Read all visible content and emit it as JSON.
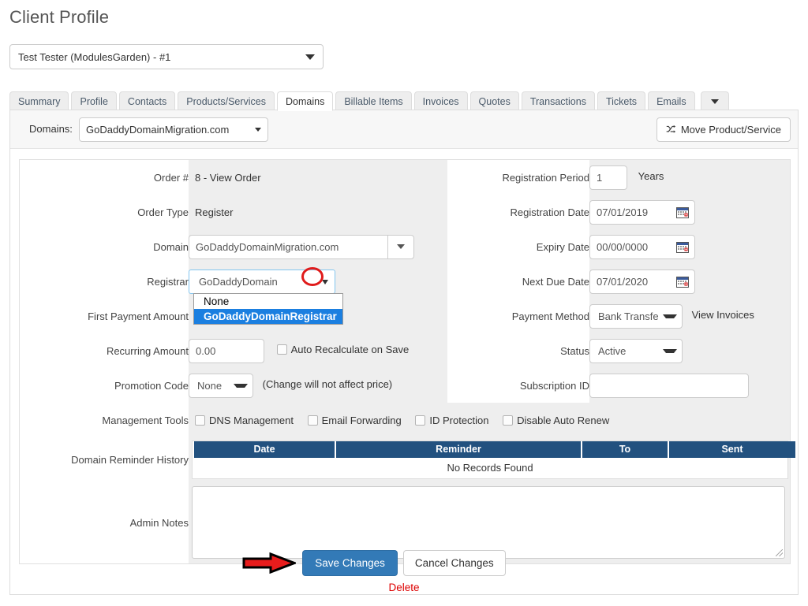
{
  "page": {
    "title": "Client Profile"
  },
  "client_select": {
    "value": "Test Tester (ModulesGarden) - #1",
    "caret": "chevron-down-icon"
  },
  "tabs": [
    {
      "label": "Summary",
      "active": false
    },
    {
      "label": "Profile",
      "active": false
    },
    {
      "label": "Contacts",
      "active": false
    },
    {
      "label": "Products/Services",
      "active": false
    },
    {
      "label": "Domains",
      "active": true
    },
    {
      "label": "Billable Items",
      "active": false
    },
    {
      "label": "Invoices",
      "active": false
    },
    {
      "label": "Quotes",
      "active": false
    },
    {
      "label": "Transactions",
      "active": false
    },
    {
      "label": "Tickets",
      "active": false
    },
    {
      "label": "Emails",
      "active": false
    }
  ],
  "panel_topbar": {
    "domains_label": "Domains:",
    "domains_value": "GoDaddyDomainMigration.com",
    "move_button": "Move Product/Service",
    "move_icon": "shuffle-icon"
  },
  "form": {
    "left": {
      "order_number_label": "Order #",
      "order_number_value": "8 - View Order",
      "order_type_label": "Order Type",
      "order_type_value": "Register",
      "domain_label": "Domain",
      "domain_value": "GoDaddyDomainMigration.com",
      "registrar_label": "Registrar",
      "registrar_value": "GoDaddyDomain",
      "registrar_options": [
        "None",
        "GoDaddyDomainRegistrar"
      ],
      "registrar_selected_option": "GoDaddyDomainRegistrar",
      "first_payment_label": "First Payment Amount",
      "first_payment_value": "",
      "recurring_amount_label": "Recurring Amount",
      "recurring_amount_value": "0.00",
      "auto_recalculate_label": "Auto Recalculate on Save",
      "promotion_code_label": "Promotion Code",
      "promotion_code_value": "None",
      "promotion_note": "(Change will not affect price)",
      "management_tools_label": "Management Tools",
      "management_tools": [
        "DNS Management",
        "Email Forwarding",
        "ID Protection",
        "Disable Auto Renew"
      ],
      "reminder_history_label": "Domain Reminder History",
      "admin_notes_label": "Admin Notes",
      "admin_notes_value": ""
    },
    "right": {
      "registration_period_label": "Registration Period",
      "registration_period_value": "1",
      "registration_period_unit": "Years",
      "registration_date_label": "Registration Date",
      "registration_date_value": "07/01/2019",
      "expiry_date_label": "Expiry Date",
      "expiry_date_value": "00/00/0000",
      "next_due_date_label": "Next Due Date",
      "next_due_date_value": "07/01/2020",
      "payment_method_label": "Payment Method",
      "payment_method_value": "Bank Transfe",
      "view_invoices_link": "View Invoices",
      "status_label": "Status",
      "status_value": "Active",
      "subscription_id_label": "Subscription ID",
      "subscription_id_value": ""
    }
  },
  "reminder_history": {
    "columns": [
      "Date",
      "Reminder",
      "To",
      "Sent"
    ],
    "empty_text": "No Records Found",
    "rows": []
  },
  "footer": {
    "save_label": "Save Changes",
    "cancel_label": "Cancel Changes",
    "delete_label": "Delete"
  },
  "colors": {
    "primary_button": "#337ab7",
    "table_header": "#22517f",
    "annotation_red": "#e01b1b",
    "delete_link": "#dd0000",
    "option_highlight": "#1b7fe0",
    "row_value_bg": "#eeeeee"
  },
  "annotations": {
    "circle_target": "registrar-dropdown-arrow",
    "arrow_target": "save-changes-button"
  }
}
